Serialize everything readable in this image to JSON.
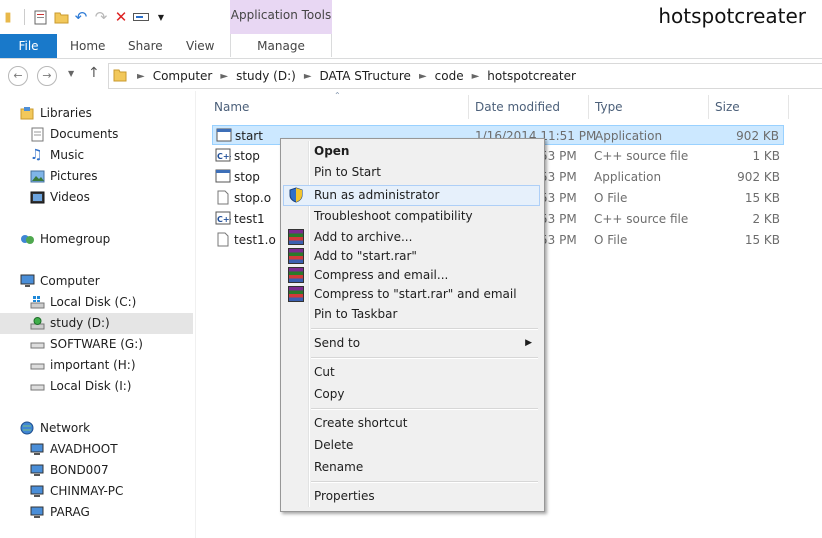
{
  "window": {
    "title": "hotspotcreater",
    "context_tab_group": "Application Tools"
  },
  "ribbon": {
    "file": "File",
    "home": "Home",
    "share": "Share",
    "view": "View",
    "manage": "Manage"
  },
  "address": {
    "crumbs": [
      "Computer",
      "study (D:)",
      "DATA STructure",
      "code",
      "hotspotcreater"
    ]
  },
  "navpane": {
    "libraries": "Libraries",
    "documents": "Documents",
    "music": "Music",
    "pictures": "Pictures",
    "videos": "Videos",
    "homegroup": "Homegroup",
    "computer": "Computer",
    "local_c": "Local Disk (C:)",
    "study_d": "study (D:)",
    "software_g": "SOFTWARE (G:)",
    "important_h": "important (H:)",
    "local_i": "Local Disk (I:)",
    "network": "Network",
    "avadhoot": "AVADHOOT",
    "bond007": "BOND007",
    "chinmay": "CHINMAY-PC",
    "parag": "PARAG"
  },
  "columns": {
    "name": "Name",
    "date": "Date modified",
    "type": "Type",
    "size": "Size"
  },
  "files": [
    {
      "name": "start",
      "date": "1/16/2014 11:51 PM",
      "type": "Application",
      "size": "902 KB",
      "icon": "application-icon"
    },
    {
      "name": "stop",
      "date": "53 PM",
      "type": "C++ source file",
      "size": "1 KB",
      "icon": "cpp-file-icon"
    },
    {
      "name": "stop",
      "date": "53 PM",
      "type": "Application",
      "size": "902 KB",
      "icon": "application-icon"
    },
    {
      "name": "stop.o",
      "date": "53 PM",
      "type": "O File",
      "size": "15 KB",
      "icon": "file-icon"
    },
    {
      "name": "test1",
      "date": "53 PM",
      "type": "C++ source file",
      "size": "2 KB",
      "icon": "cpp-file-icon"
    },
    {
      "name": "test1.o",
      "date": "53 PM",
      "type": "O File",
      "size": "15 KB",
      "icon": "file-icon"
    }
  ],
  "context_menu": {
    "open": "Open",
    "pin_start": "Pin to Start",
    "run_admin": "Run as administrator",
    "troubleshoot": "Troubleshoot compatibility",
    "add_archive": "Add to archive...",
    "add_rar": "Add to \"start.rar\"",
    "compress_email": "Compress and email...",
    "compress_rar_email": "Compress to \"start.rar\" and email",
    "pin_taskbar": "Pin to Taskbar",
    "send_to": "Send to",
    "cut": "Cut",
    "copy": "Copy",
    "create_shortcut": "Create shortcut",
    "delete": "Delete",
    "rename": "Rename",
    "properties": "Properties"
  },
  "colors": {
    "file_tab": "#1979ca",
    "context_tab": "#e8d7f3",
    "selection": "#cce8ff",
    "menu_hover": "#e6f0fb"
  }
}
